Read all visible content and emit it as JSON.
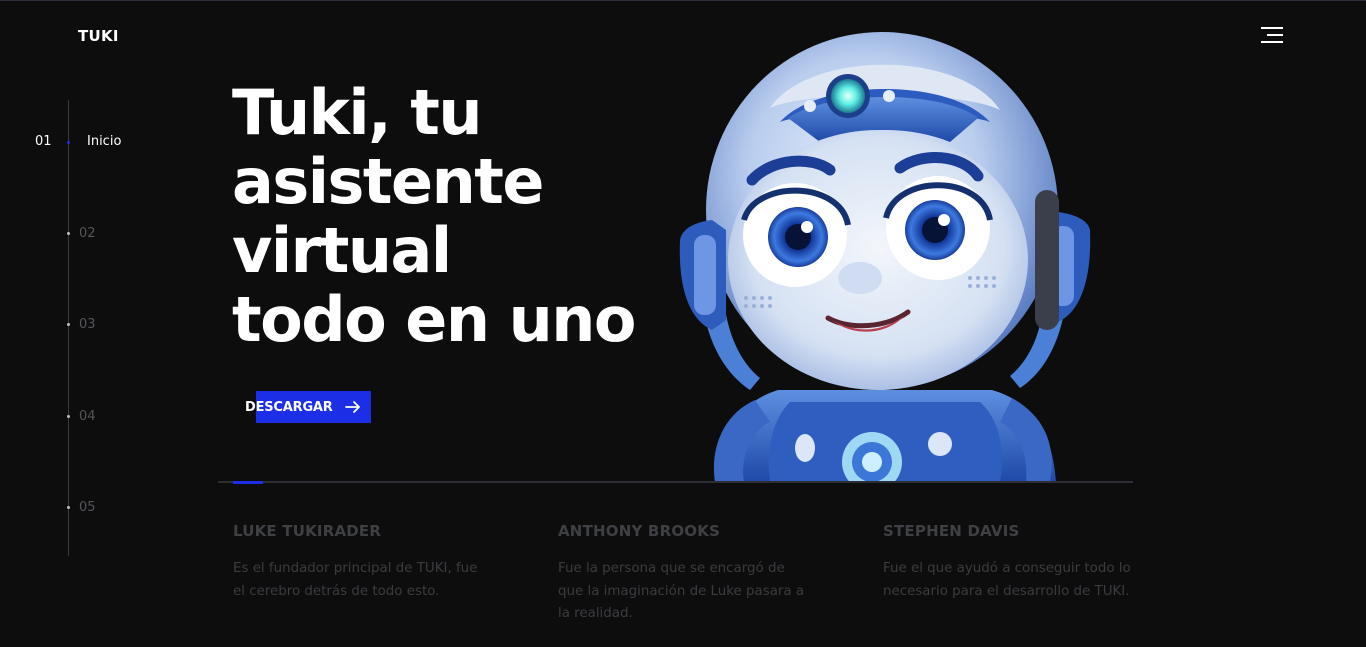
{
  "header": {
    "logo": "TUKI",
    "menu_icon": "hamburger-menu-icon"
  },
  "sidebar": {
    "active_label": "Inicio",
    "items": [
      {
        "number": "01",
        "active": true
      },
      {
        "number": "02",
        "active": false
      },
      {
        "number": "03",
        "active": false
      },
      {
        "number": "04",
        "active": false
      },
      {
        "number": "05",
        "active": false
      }
    ]
  },
  "hero": {
    "title_lines": [
      "Tuki, tu",
      "asistente",
      "virtual",
      "todo en uno"
    ],
    "cta_label": "DESCARGAR",
    "cta_icon": "arrow-right-icon",
    "image": "robot-illustration"
  },
  "team": [
    {
      "name": "LUKE TUKIRADER",
      "description": "Es el fundador principal de TUKI, fue el cerebro detrás de todo esto."
    },
    {
      "name": "ANTHONY BROOKS",
      "description": "Fue la persona que se encargó de que la imaginación de Luke pasara a la realidad."
    },
    {
      "name": "STEPHEN DAVIS",
      "description": "Fue el que ayudó a conseguir todo lo necesario para el desarrollo de TUKI."
    }
  ],
  "colors": {
    "background": "#0d0d0e",
    "accent": "#1c2fe6",
    "muted_text": "#3f4044"
  }
}
